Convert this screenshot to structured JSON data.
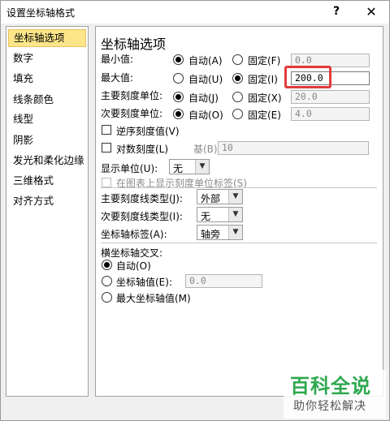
{
  "window": {
    "title": "设置坐标轴格式",
    "help": "?",
    "close": "✕"
  },
  "sidebar": {
    "items": [
      {
        "label": "坐标轴选项"
      },
      {
        "label": "数字"
      },
      {
        "label": "填充"
      },
      {
        "label": "线条颜色"
      },
      {
        "label": "线型"
      },
      {
        "label": "阴影"
      },
      {
        "label": "发光和柔化边缘"
      },
      {
        "label": "三维格式"
      },
      {
        "label": "对齐方式"
      }
    ]
  },
  "panel": {
    "heading": "坐标轴选项",
    "min": {
      "label": "最小值:",
      "auto": "自动(A)",
      "fixed": "固定(F)",
      "value": "0.0",
      "selected": "auto"
    },
    "max": {
      "label": "最大值:",
      "auto": "自动(U)",
      "fixed": "固定(I)",
      "value": "200.0",
      "selected": "fixed"
    },
    "major_unit": {
      "label": "主要刻度单位:",
      "auto": "自动(J)",
      "fixed": "固定(X)",
      "value": "20.0",
      "selected": "auto"
    },
    "minor_unit": {
      "label": "次要刻度单位:",
      "auto": "自动(O)",
      "fixed": "固定(E)",
      "value": "4.0",
      "selected": "auto"
    },
    "reverse": {
      "label": "逆序刻度值(V)"
    },
    "log": {
      "label": "对数刻度(L)",
      "base_label": "基(B):",
      "base_value": "10"
    },
    "display_units": {
      "label": "显示单位(U):",
      "value": "无"
    },
    "show_units_label": {
      "label": "在图表上显示刻度单位标签(S)"
    },
    "major_tick": {
      "label": "主要刻度线类型(J):",
      "value": "外部"
    },
    "minor_tick": {
      "label": "次要刻度线类型(I):",
      "value": "无"
    },
    "axis_labels": {
      "label": "坐标轴标签(A):",
      "value": "轴旁"
    },
    "crosses": {
      "label": "横坐标轴交叉:",
      "auto": "自动(O)",
      "value_label": "坐标轴值(E):",
      "value": "0.0",
      "max_label": "最大坐标轴值(M)"
    }
  },
  "watermark": {
    "big": "百科全说",
    "small": "助你轻松解决"
  },
  "colors": {
    "highlight": "#e23b3b",
    "selected_item": "#fde68a",
    "watermark_green": "#2fa84f"
  }
}
